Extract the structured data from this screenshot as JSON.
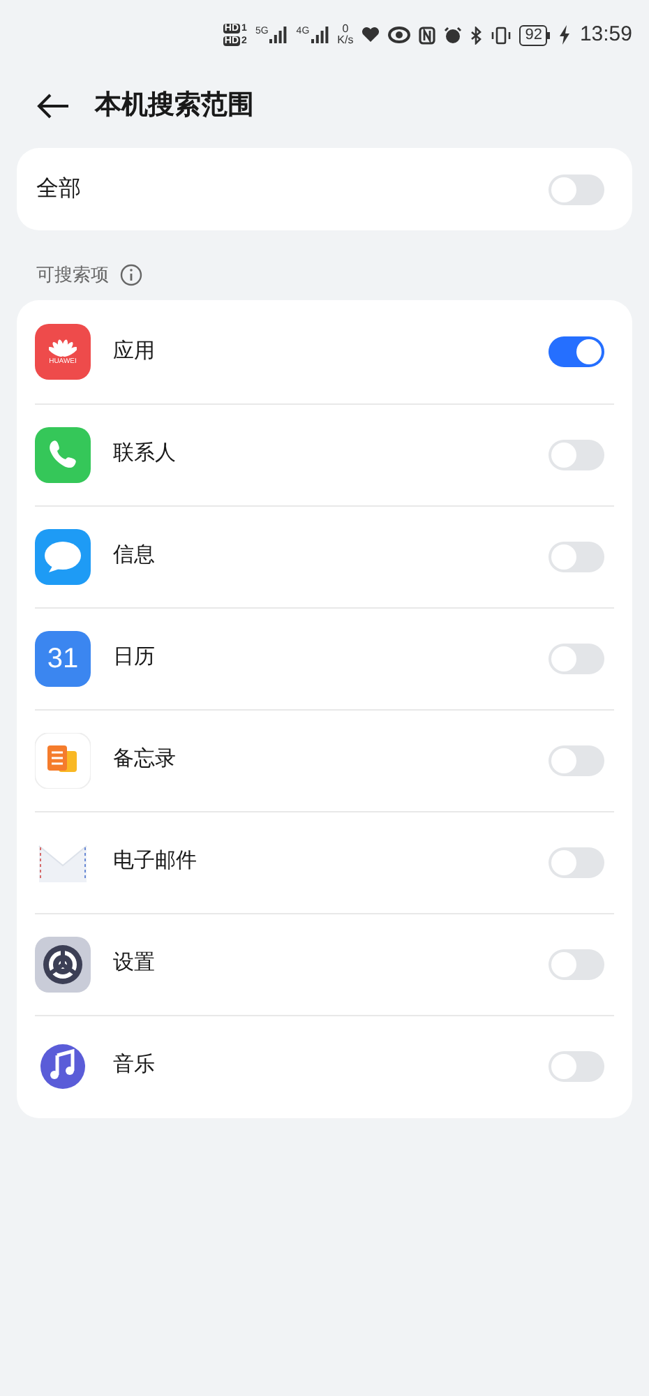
{
  "status_bar": {
    "sims": [
      {
        "label": "HD",
        "slot": "1"
      },
      {
        "label": "HD",
        "slot": "2"
      }
    ],
    "networks": [
      "5G",
      "4G"
    ],
    "speed_value": "0",
    "speed_unit": "K/s",
    "battery": "92",
    "time": "13:59"
  },
  "header": {
    "title": "本机搜索范围"
  },
  "all": {
    "label": "全部",
    "on": false
  },
  "section": {
    "label": "可搜索项"
  },
  "items": [
    {
      "kind": "huawei",
      "icon_text": "HUAWEI",
      "label": "应用",
      "on": true
    },
    {
      "kind": "phone",
      "label": "联系人",
      "on": false
    },
    {
      "kind": "message",
      "label": "信息",
      "on": false
    },
    {
      "kind": "calendar",
      "icon_text": "31",
      "label": "日历",
      "on": false
    },
    {
      "kind": "notes",
      "label": "备忘录",
      "on": false
    },
    {
      "kind": "mail",
      "label": "电子邮件",
      "on": false
    },
    {
      "kind": "settings",
      "label": "设置",
      "on": false
    },
    {
      "kind": "music",
      "label": "音乐",
      "on": false
    }
  ]
}
